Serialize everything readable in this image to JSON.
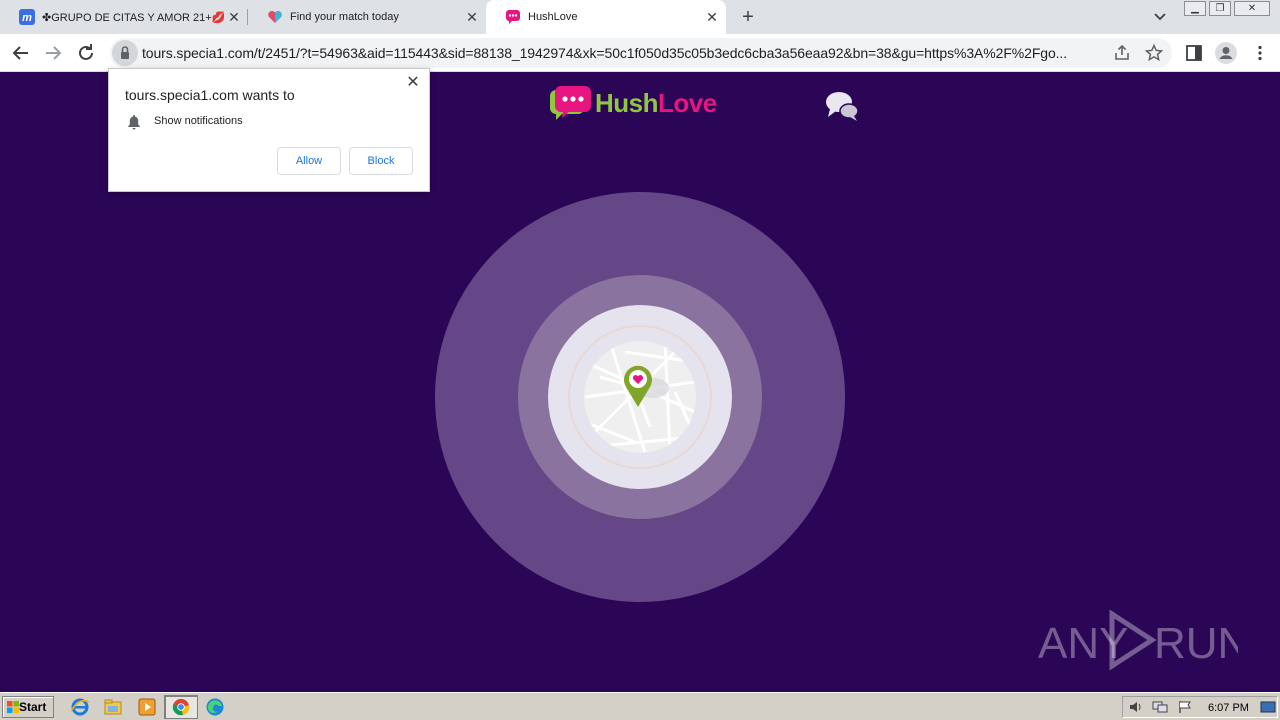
{
  "browser": {
    "tabs": [
      {
        "title": "✤GRUPO DE CITAS Y AMOR 21+💋💋",
        "icon": "m-icon",
        "active": false
      },
      {
        "title": "Find your match today",
        "icon": "heart-icon",
        "active": false
      },
      {
        "title": "HushLove",
        "icon": "hushlove-icon",
        "active": true
      }
    ],
    "url": "tours.specia1.com/t/2451/?t=54963&aid=115443&sid=88138_1942974&xk=50c1f050d35c05b3edc6cba3a56eaa92&bn=38&gu=https%3A%2F%2Fgo..."
  },
  "prompt": {
    "title": "tours.specia1.com wants to",
    "permission": "Show notifications",
    "allow_label": "Allow",
    "block_label": "Block"
  },
  "page": {
    "logo_hush": "Hush",
    "logo_love": "Love",
    "colors": {
      "background": "#2b0656",
      "accent_green": "#8fc83f",
      "accent_pink": "#e6157f"
    }
  },
  "watermark": {
    "left": "ANY",
    "right": "RUN"
  },
  "taskbar": {
    "start_label": "Start",
    "clock": "6:07 PM"
  }
}
